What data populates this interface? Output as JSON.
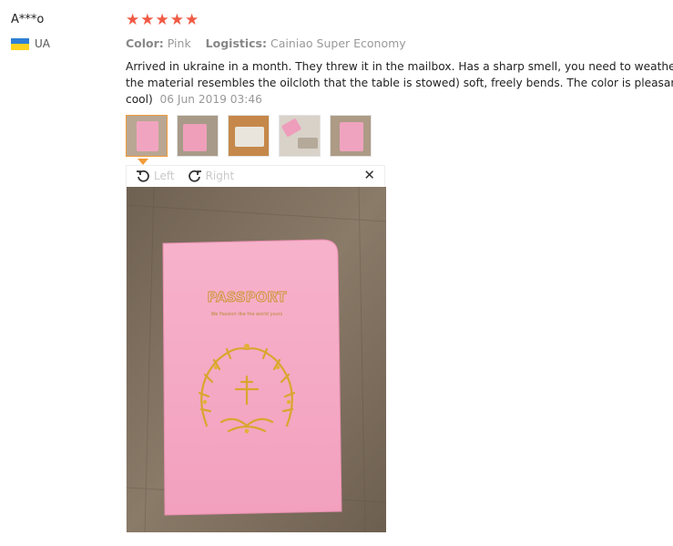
{
  "reviewer": {
    "name": "A***o",
    "country": "UA"
  },
  "review": {
    "rating": 5,
    "stars": [
      "★",
      "★",
      "★",
      "★",
      "★"
    ],
    "color_label": "Color:",
    "color_value": "Pink",
    "logistics_label": "Logistics:",
    "logistics_value": "Cainiao Super Economy",
    "text_line1": "Arrived in ukraine in a month. They threw it in the mailbox. Has a sharp smell, you need to weathere",
    "text_line2": "the material resembles the oilcloth that the table is stowed) soft, freely bends. The color is pleasant.",
    "text_line3": "cool)",
    "date": "06 Jun 2019 03:46"
  },
  "viewer": {
    "rotate_left_label": "Left",
    "rotate_right_label": "Right",
    "close_glyph": "✕",
    "photo_text_main": "PASSPORT",
    "photo_text_sub": "We Passion like the world yours"
  },
  "colors": {
    "star": "#f05a44",
    "active_thumb_border": "#f29b3a",
    "flag_top": "#2f7fd6",
    "flag_bottom": "#ffd21f",
    "passport_pink": "#f3a3c0",
    "gold": "#d9a62e",
    "table_wood": "#7e6d5b"
  },
  "thumbnails": [
    {
      "name": "thumb-1",
      "active": true
    },
    {
      "name": "thumb-2",
      "active": false
    },
    {
      "name": "thumb-3",
      "active": false
    },
    {
      "name": "thumb-4",
      "active": false
    },
    {
      "name": "thumb-5",
      "active": false
    }
  ]
}
